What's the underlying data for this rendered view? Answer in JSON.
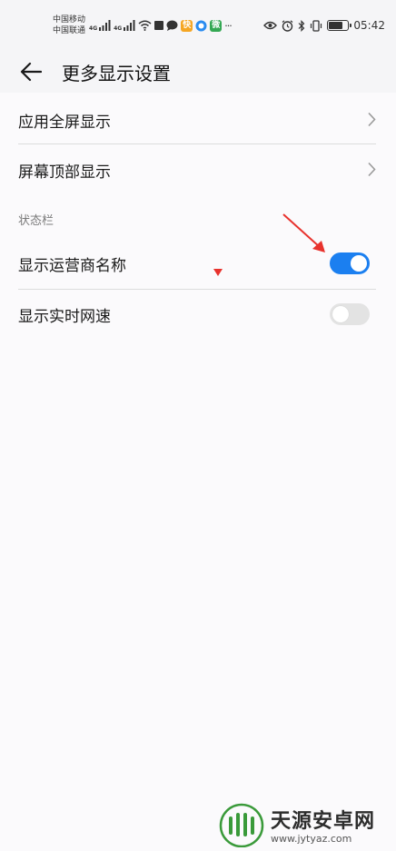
{
  "status_bar": {
    "carrier_1": "中国移动",
    "carrier_2": "中国联通",
    "net_tag_1": "4G",
    "net_tag_2": "4G",
    "app_icon_1_text": "快",
    "app_icon_2_text": "微",
    "more": "···",
    "time": "05:42",
    "battery_level": 0.72
  },
  "header": {
    "title": "更多显示设置"
  },
  "rows": {
    "fullscreen": {
      "label": "应用全屏显示"
    },
    "notch": {
      "label": "屏幕顶部显示"
    }
  },
  "section": {
    "title": "状态栏"
  },
  "toggles": {
    "carrier_name": {
      "label": "显示运营商名称",
      "on": true
    },
    "network_speed": {
      "label": "显示实时网速",
      "on": false
    }
  },
  "watermark": {
    "name": "天源安卓网",
    "url": "www.jytyaz.com"
  },
  "colors": {
    "accent": "#1b7ff0",
    "annotation": "#e8322d",
    "logo_green": "#3a9a3a"
  }
}
